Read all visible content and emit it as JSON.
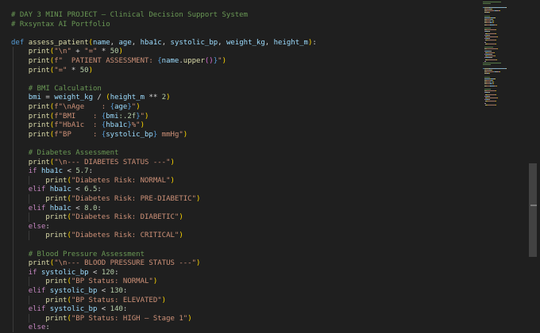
{
  "editor": {
    "language": "python",
    "lines": [
      {
        "tokens": [
          {
            "t": "# DAY 3 MINI PROJECT – Clinical Decision Support System",
            "c": "com"
          }
        ]
      },
      {
        "tokens": [
          {
            "t": "# Rxsyntax AI Portfolio",
            "c": "com"
          }
        ]
      },
      {
        "tokens": []
      },
      {
        "tokens": [
          {
            "t": "def ",
            "c": "kw"
          },
          {
            "t": "assess_patient",
            "c": "fn"
          },
          {
            "t": "(",
            "c": "brk"
          },
          {
            "t": "name",
            "c": "var"
          },
          {
            "t": ", ",
            "c": "txt"
          },
          {
            "t": "age",
            "c": "var"
          },
          {
            "t": ", ",
            "c": "txt"
          },
          {
            "t": "hba1c",
            "c": "var"
          },
          {
            "t": ", ",
            "c": "txt"
          },
          {
            "t": "systolic_bp",
            "c": "var"
          },
          {
            "t": ", ",
            "c": "txt"
          },
          {
            "t": "weight_kg",
            "c": "var"
          },
          {
            "t": ", ",
            "c": "txt"
          },
          {
            "t": "height_m",
            "c": "var"
          },
          {
            "t": ")",
            "c": "brk"
          },
          {
            "t": ":",
            "c": "txt"
          }
        ]
      },
      {
        "tokens": [
          {
            "t": "    ",
            "c": "txt"
          },
          {
            "t": "print",
            "c": "fn"
          },
          {
            "t": "(",
            "c": "brk"
          },
          {
            "t": "\"\\n\"",
            "c": "str"
          },
          {
            "t": " + ",
            "c": "txt"
          },
          {
            "t": "\"=\"",
            "c": "str"
          },
          {
            "t": " * ",
            "c": "txt"
          },
          {
            "t": "50",
            "c": "num"
          },
          {
            "t": ")",
            "c": "brk"
          }
        ]
      },
      {
        "tokens": [
          {
            "t": "    ",
            "c": "txt"
          },
          {
            "t": "print",
            "c": "fn"
          },
          {
            "t": "(",
            "c": "brk"
          },
          {
            "t": "f\"  PATIENT ASSESSMENT: ",
            "c": "str"
          },
          {
            "t": "{",
            "c": "kw"
          },
          {
            "t": "name",
            "c": "var"
          },
          {
            "t": ".",
            "c": "txt"
          },
          {
            "t": "upper",
            "c": "fn"
          },
          {
            "t": "()",
            "c": "brk2"
          },
          {
            "t": "}",
            "c": "kw"
          },
          {
            "t": "\"",
            "c": "str"
          },
          {
            "t": ")",
            "c": "brk"
          }
        ]
      },
      {
        "tokens": [
          {
            "t": "    ",
            "c": "txt"
          },
          {
            "t": "print",
            "c": "fn"
          },
          {
            "t": "(",
            "c": "brk"
          },
          {
            "t": "\"=\"",
            "c": "str"
          },
          {
            "t": " * ",
            "c": "txt"
          },
          {
            "t": "50",
            "c": "num"
          },
          {
            "t": ")",
            "c": "brk"
          }
        ]
      },
      {
        "tokens": []
      },
      {
        "tokens": [
          {
            "t": "    ",
            "c": "txt"
          },
          {
            "t": "# BMI Calculation",
            "c": "com"
          }
        ]
      },
      {
        "tokens": [
          {
            "t": "    ",
            "c": "txt"
          },
          {
            "t": "bmi",
            "c": "var"
          },
          {
            "t": " = ",
            "c": "txt"
          },
          {
            "t": "weight_kg",
            "c": "var"
          },
          {
            "t": " / ",
            "c": "txt"
          },
          {
            "t": "(",
            "c": "brk"
          },
          {
            "t": "height_m",
            "c": "var"
          },
          {
            "t": " ** ",
            "c": "txt"
          },
          {
            "t": "2",
            "c": "num"
          },
          {
            "t": ")",
            "c": "brk"
          }
        ]
      },
      {
        "tokens": [
          {
            "t": "    ",
            "c": "txt"
          },
          {
            "t": "print",
            "c": "fn"
          },
          {
            "t": "(",
            "c": "brk"
          },
          {
            "t": "f\"\\nAge    : ",
            "c": "str"
          },
          {
            "t": "{",
            "c": "kw"
          },
          {
            "t": "age",
            "c": "var"
          },
          {
            "t": "}",
            "c": "kw"
          },
          {
            "t": "\"",
            "c": "str"
          },
          {
            "t": ")",
            "c": "brk"
          }
        ]
      },
      {
        "tokens": [
          {
            "t": "    ",
            "c": "txt"
          },
          {
            "t": "print",
            "c": "fn"
          },
          {
            "t": "(",
            "c": "brk"
          },
          {
            "t": "f\"BMI    : ",
            "c": "str"
          },
          {
            "t": "{",
            "c": "kw"
          },
          {
            "t": "bmi",
            "c": "var"
          },
          {
            "t": ":.2f",
            "c": "num"
          },
          {
            "t": "}",
            "c": "kw"
          },
          {
            "t": "\"",
            "c": "str"
          },
          {
            "t": ")",
            "c": "brk"
          }
        ]
      },
      {
        "tokens": [
          {
            "t": "    ",
            "c": "txt"
          },
          {
            "t": "print",
            "c": "fn"
          },
          {
            "t": "(",
            "c": "brk"
          },
          {
            "t": "f\"HbA1c  : ",
            "c": "str"
          },
          {
            "t": "{",
            "c": "kw"
          },
          {
            "t": "hba1c",
            "c": "var"
          },
          {
            "t": "}",
            "c": "kw"
          },
          {
            "t": "%\"",
            "c": "str"
          },
          {
            "t": ")",
            "c": "brk"
          }
        ]
      },
      {
        "tokens": [
          {
            "t": "    ",
            "c": "txt"
          },
          {
            "t": "print",
            "c": "fn"
          },
          {
            "t": "(",
            "c": "brk"
          },
          {
            "t": "f\"BP     : ",
            "c": "str"
          },
          {
            "t": "{",
            "c": "kw"
          },
          {
            "t": "systolic_bp",
            "c": "var"
          },
          {
            "t": "}",
            "c": "kw"
          },
          {
            "t": " mmHg\"",
            "c": "str"
          },
          {
            "t": ")",
            "c": "brk"
          }
        ]
      },
      {
        "tokens": []
      },
      {
        "tokens": [
          {
            "t": "    ",
            "c": "txt"
          },
          {
            "t": "# Diabetes Assessment",
            "c": "com"
          }
        ]
      },
      {
        "tokens": [
          {
            "t": "    ",
            "c": "txt"
          },
          {
            "t": "print",
            "c": "fn"
          },
          {
            "t": "(",
            "c": "brk"
          },
          {
            "t": "\"\\n--- DIABETES STATUS ---\"",
            "c": "str"
          },
          {
            "t": ")",
            "c": "brk"
          }
        ]
      },
      {
        "tokens": [
          {
            "t": "    ",
            "c": "txt"
          },
          {
            "t": "if ",
            "c": "ctl"
          },
          {
            "t": "hba1c",
            "c": "var"
          },
          {
            "t": " < ",
            "c": "txt"
          },
          {
            "t": "5.7",
            "c": "num"
          },
          {
            "t": ":",
            "c": "txt"
          }
        ]
      },
      {
        "tokens": [
          {
            "t": "        ",
            "c": "txt"
          },
          {
            "t": "print",
            "c": "fn"
          },
          {
            "t": "(",
            "c": "brk"
          },
          {
            "t": "\"Diabetes Risk: NORMAL\"",
            "c": "str"
          },
          {
            "t": ")",
            "c": "brk"
          }
        ]
      },
      {
        "tokens": [
          {
            "t": "    ",
            "c": "txt"
          },
          {
            "t": "elif ",
            "c": "ctl"
          },
          {
            "t": "hba1c",
            "c": "var"
          },
          {
            "t": " < ",
            "c": "txt"
          },
          {
            "t": "6.5",
            "c": "num"
          },
          {
            "t": ":",
            "c": "txt"
          }
        ]
      },
      {
        "tokens": [
          {
            "t": "        ",
            "c": "txt"
          },
          {
            "t": "print",
            "c": "fn"
          },
          {
            "t": "(",
            "c": "brk"
          },
          {
            "t": "\"Diabetes Risk: PRE-DIABETIC\"",
            "c": "str"
          },
          {
            "t": ")",
            "c": "brk"
          }
        ]
      },
      {
        "tokens": [
          {
            "t": "    ",
            "c": "txt"
          },
          {
            "t": "elif ",
            "c": "ctl"
          },
          {
            "t": "hba1c",
            "c": "var"
          },
          {
            "t": " < ",
            "c": "txt"
          },
          {
            "t": "8.0",
            "c": "num"
          },
          {
            "t": ":",
            "c": "txt"
          }
        ]
      },
      {
        "tokens": [
          {
            "t": "        ",
            "c": "txt"
          },
          {
            "t": "print",
            "c": "fn"
          },
          {
            "t": "(",
            "c": "brk"
          },
          {
            "t": "\"Diabetes Risk: DIABETIC\"",
            "c": "str"
          },
          {
            "t": ")",
            "c": "brk"
          }
        ]
      },
      {
        "tokens": [
          {
            "t": "    ",
            "c": "txt"
          },
          {
            "t": "else",
            "c": "ctl"
          },
          {
            "t": ":",
            "c": "txt"
          }
        ]
      },
      {
        "tokens": [
          {
            "t": "        ",
            "c": "txt"
          },
          {
            "t": "print",
            "c": "fn"
          },
          {
            "t": "(",
            "c": "brk"
          },
          {
            "t": "\"Diabetes Risk: CRITICAL\"",
            "c": "str"
          },
          {
            "t": ")",
            "c": "brk"
          }
        ]
      },
      {
        "tokens": []
      },
      {
        "tokens": [
          {
            "t": "    ",
            "c": "txt"
          },
          {
            "t": "# Blood Pressure Assessment",
            "c": "com"
          }
        ]
      },
      {
        "tokens": [
          {
            "t": "    ",
            "c": "txt"
          },
          {
            "t": "print",
            "c": "fn"
          },
          {
            "t": "(",
            "c": "brk"
          },
          {
            "t": "\"\\n--- BLOOD PRESSURE STATUS ---\"",
            "c": "str"
          },
          {
            "t": ")",
            "c": "brk"
          }
        ]
      },
      {
        "tokens": [
          {
            "t": "    ",
            "c": "txt"
          },
          {
            "t": "if ",
            "c": "ctl"
          },
          {
            "t": "systolic_bp",
            "c": "var"
          },
          {
            "t": " < ",
            "c": "txt"
          },
          {
            "t": "120",
            "c": "num"
          },
          {
            "t": ":",
            "c": "txt"
          }
        ]
      },
      {
        "tokens": [
          {
            "t": "        ",
            "c": "txt"
          },
          {
            "t": "print",
            "c": "fn"
          },
          {
            "t": "(",
            "c": "brk"
          },
          {
            "t": "\"BP Status: NORMAL\"",
            "c": "str"
          },
          {
            "t": ")",
            "c": "brk"
          }
        ]
      },
      {
        "tokens": [
          {
            "t": "    ",
            "c": "txt"
          },
          {
            "t": "elif ",
            "c": "ctl"
          },
          {
            "t": "systolic_bp",
            "c": "var"
          },
          {
            "t": " < ",
            "c": "txt"
          },
          {
            "t": "130",
            "c": "num"
          },
          {
            "t": ":",
            "c": "txt"
          }
        ]
      },
      {
        "tokens": [
          {
            "t": "        ",
            "c": "txt"
          },
          {
            "t": "print",
            "c": "fn"
          },
          {
            "t": "(",
            "c": "brk"
          },
          {
            "t": "\"BP Status: ELEVATED\"",
            "c": "str"
          },
          {
            "t": ")",
            "c": "brk"
          }
        ]
      },
      {
        "tokens": [
          {
            "t": "    ",
            "c": "txt"
          },
          {
            "t": "elif ",
            "c": "ctl"
          },
          {
            "t": "systolic_bp",
            "c": "var"
          },
          {
            "t": " < ",
            "c": "txt"
          },
          {
            "t": "140",
            "c": "num"
          },
          {
            "t": ":",
            "c": "txt"
          }
        ]
      },
      {
        "tokens": [
          {
            "t": "        ",
            "c": "txt"
          },
          {
            "t": "print",
            "c": "fn"
          },
          {
            "t": "(",
            "c": "brk"
          },
          {
            "t": "\"BP Status: HIGH – Stage 1\"",
            "c": "str"
          },
          {
            "t": ")",
            "c": "brk"
          }
        ]
      },
      {
        "tokens": [
          {
            "t": "    ",
            "c": "txt"
          },
          {
            "t": "else",
            "c": "ctl"
          },
          {
            "t": ":",
            "c": "txt"
          }
        ]
      }
    ]
  }
}
